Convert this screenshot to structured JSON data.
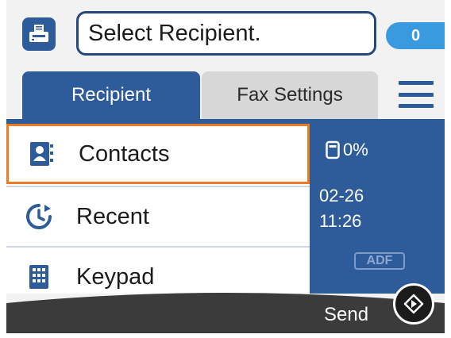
{
  "header": {
    "recipient_field_text": "Select Recipient.",
    "recipient_count": "0",
    "fax_icon": "fax-machine-icon"
  },
  "tabs": [
    {
      "label": "Recipient",
      "active": true
    },
    {
      "label": "Fax Settings",
      "active": false
    }
  ],
  "menu_icon": "hamburger-menu-icon",
  "list": {
    "items": [
      {
        "label": "Contacts",
        "icon": "contacts-book-icon",
        "selected": true
      },
      {
        "label": "Recent",
        "icon": "recent-history-icon",
        "selected": false
      },
      {
        "label": "Keypad",
        "icon": "keypad-icon",
        "selected": false
      }
    ]
  },
  "status": {
    "memory": "0%",
    "date": "02-26",
    "time": "11:26",
    "adf": "ADF"
  },
  "footer": {
    "send_label": "Send"
  },
  "colors": {
    "primary": "#2e5b9a",
    "selection": "#ef7b22",
    "badge": "#3a9ae0",
    "footer": "#3b3b3b"
  }
}
